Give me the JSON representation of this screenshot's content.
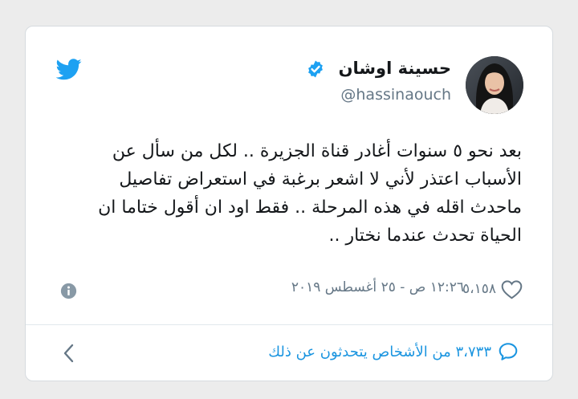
{
  "tweet": {
    "author_name": "حسينة اوشان",
    "author_handle": "@hassinaouch",
    "text_lines": [
      "بعد نحو ٥ سنوات أغادر قناة الجزيرة .. لكل من سأل عن",
      "الأسباب اعتذر لأني لا اشعر برغبة في استعراض تفاصيل",
      "ماحدث اقله في هذه المرحلة .. فقط اود ان أقول ختاما ان",
      "الحياة تحدث عندما نختار .."
    ],
    "timestamp": "١٢:٢٦ ص - ٢٥ أغسطس ٢٠١٩",
    "like_count": "٥،١٥٨",
    "conversation_text": "٣،٧٣٣ من الأشخاص يتحدثون عن ذلك"
  },
  "icons": {
    "brand": "twitter-bird-icon",
    "verified": "verified-badge-icon",
    "info": "info-icon",
    "like": "heart-icon",
    "reply": "speech-bubble-icon",
    "navigate": "chevron-left-icon"
  },
  "colors": {
    "brand_blue": "#1da1f2",
    "link_blue": "#1b95e0",
    "text_primary": "#14171a",
    "text_secondary": "#657786",
    "card_border": "#d6dbdf",
    "page_background": "#ececec"
  }
}
